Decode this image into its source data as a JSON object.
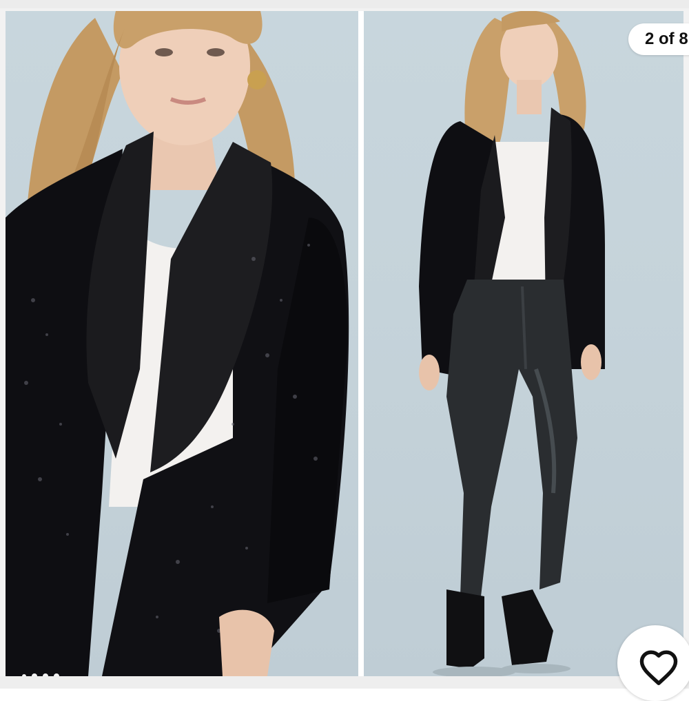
{
  "gallery": {
    "counter": "2 of 8",
    "dot_count": 4,
    "like_icon": "heart-outline-icon"
  },
  "colors": {
    "backdrop": "#c6d4db",
    "sequin_jacket": "#0d0d10",
    "lapel": "#1a1a1c",
    "camisole": "#f3f1ef",
    "hair": "#c9a06a",
    "leggings": "#2a2d30"
  }
}
